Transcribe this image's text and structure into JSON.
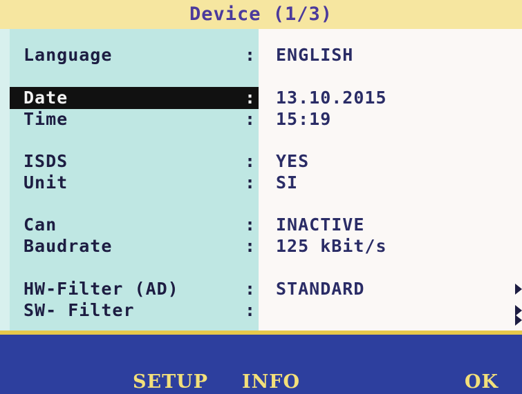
{
  "header": {
    "title": "Device (1/3)"
  },
  "settings": [
    {
      "label": "Language",
      "value": "ENGLISH"
    },
    {
      "label": "Date",
      "value": "13.10.2015"
    },
    {
      "label": "Time",
      "value": "15:19"
    },
    {
      "label": "ISDS",
      "value": "YES"
    },
    {
      "label": "Unit",
      "value": "SI"
    },
    {
      "label": "Can",
      "value": "INACTIVE"
    },
    {
      "label": "Baudrate",
      "value": "125 kBit/s"
    },
    {
      "label": "HW-Filter (AD)",
      "value": "STANDARD"
    },
    {
      "label": "SW- Filter",
      "value": ""
    }
  ],
  "separator": ":",
  "softkeys": {
    "setup": "SETUP",
    "info": "INFO",
    "ok": "OK"
  },
  "colors": {
    "title_bg": "#f6e6a0",
    "label_panel": "#bfe7e3",
    "value_panel": "#fbf8f6",
    "bottom_bar": "#2d3f9e",
    "softkey_text": "#f3e07a",
    "selection": "#111111"
  }
}
